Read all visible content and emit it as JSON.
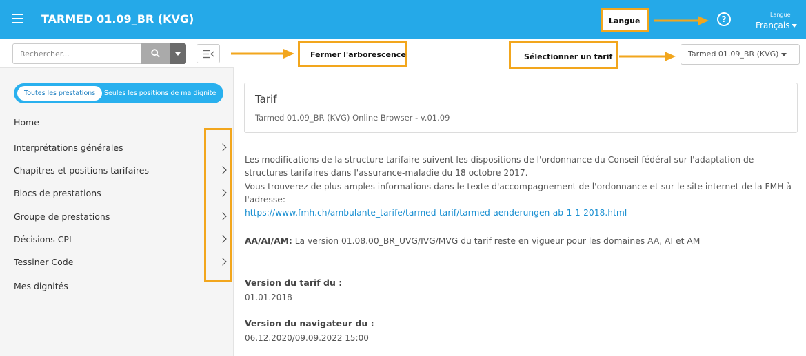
{
  "header": {
    "title": "TARMED 01.09_BR (KVG)",
    "help_icon": "help-circle-icon",
    "lang_small": "Langue",
    "lang_value": "Français"
  },
  "toolbar": {
    "search_placeholder": "Rechercher...",
    "tariff_selected": "Tarmed 01.09_BR (KVG)"
  },
  "annotations": {
    "langue": "Langue",
    "fermer": "Fermer l'arborescence",
    "select_tarif": "Sélectionner un tarif"
  },
  "sidebar": {
    "toggle_all": "Toutes les prestations",
    "toggle_mine": "Seules les positions de ma dignité",
    "items": [
      {
        "label": "Home"
      },
      {
        "label": "Interprétations générales"
      },
      {
        "label": "Chapitres et positions tarifaires"
      },
      {
        "label": "Blocs de prestations"
      },
      {
        "label": "Groupe de prestations"
      },
      {
        "label": "Décisions CPI"
      },
      {
        "label": "Tessiner Code"
      },
      {
        "label": "Mes dignités"
      }
    ]
  },
  "main": {
    "card_title": "Tarif",
    "card_subtitle": "Tarmed 01.09_BR (KVG) Online Browser - v.01.09",
    "para1": "Les modifications de la structure tarifaire suivent les dispositions de l'ordonnance du Conseil fédéral sur l'adaptation de structures tarifaires dans l'assurance-maladie du 18 octobre 2017.",
    "para2": "Vous trouverez de plus amples informations dans le texte d'accompagnement de l'ordonnance et sur le site internet de la FMH à l'adresse:",
    "link": "https://www.fmh.ch/ambulante_tarife/tarmed-tarif/tarmed-aenderungen-ab-1-1-2018.html",
    "aa_label": "AA/AI/AM:",
    "aa_text": "La version 01.08.00_BR_UVG/IVG/MVG du tarif reste en vigueur pour les domaines AA, AI et AM",
    "version_tarif_label": "Version du tarif du :",
    "version_tarif_value": "01.01.2018",
    "version_nav_label": "Version du navigateur du :",
    "version_nav_value": "06.12.2020/09.09.2022 15:00"
  },
  "colors": {
    "primary": "#25a9e8",
    "annotation": "#f2a61d"
  }
}
